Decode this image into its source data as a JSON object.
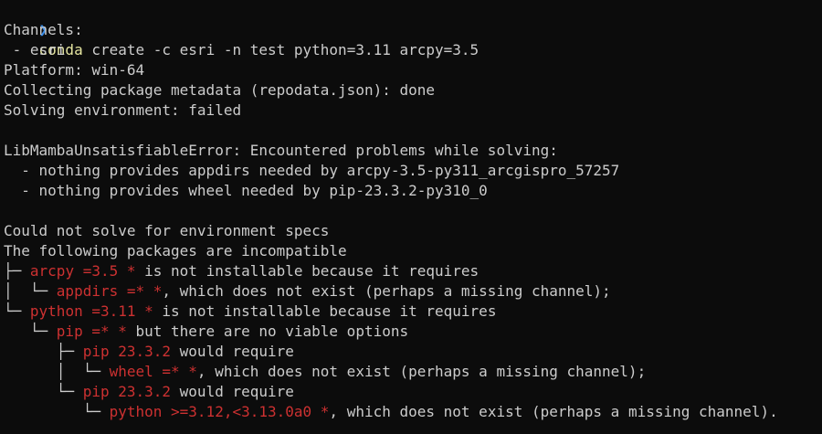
{
  "terminal": {
    "prompt_symbol": "❯",
    "command_name": "conda",
    "command_args": " create -c esri -n test python=3.11 arcpy=3.5",
    "lines": [
      "Channels:",
      " - esri",
      "Platform: win-64",
      "Collecting package metadata (repodata.json): done",
      "Solving environment: failed",
      "",
      "LibMambaUnsatisfiableError: Encountered problems while solving:",
      "  - nothing provides appdirs needed by arcpy-3.5-py311_arcgispro_57257",
      "  - nothing provides wheel needed by pip-23.3.2-py310_0",
      "",
      "Could not solve for environment specs",
      "The following packages are incompatible"
    ],
    "tree": [
      {
        "branch": "├─ ",
        "pkg": "arcpy =3.5 *",
        "rest": " is not installable because it requires"
      },
      {
        "branch": "│  └─ ",
        "pkg": "appdirs =* *",
        "rest": ", which does not exist (perhaps a missing channel);"
      },
      {
        "branch": "└─ ",
        "pkg": "python =3.11 *",
        "rest": " is not installable because it requires"
      },
      {
        "branch": "   └─ ",
        "pkg": "pip =* *",
        "rest": " but there are no viable options"
      },
      {
        "branch": "      ├─ ",
        "pkg": "pip 23.3.2",
        "rest": " would require"
      },
      {
        "branch": "      │  └─ ",
        "pkg": "wheel =* *",
        "rest": ", which does not exist (perhaps a missing channel);"
      },
      {
        "branch": "      └─ ",
        "pkg": "pip 23.3.2",
        "rest": " would require"
      },
      {
        "branch": "         └─ ",
        "pkg": "python >=3.12,<3.13.0a0 *",
        "rest": ", which does not exist (perhaps a missing channel)."
      }
    ],
    "colors": {
      "background": "#0c0c0c",
      "text": "#cccccc",
      "prompt": "#3b8eea",
      "command": "#e5e5a0",
      "error_package": "#cd3131"
    }
  }
}
